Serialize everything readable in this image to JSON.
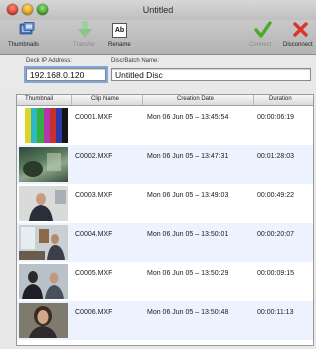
{
  "window": {
    "title": "Untitled"
  },
  "toolbar": {
    "thumbnails_label": "Thumbnails",
    "transfer_label": "Transfer",
    "rename_label": "Rename",
    "connect_label": "Connect",
    "disconnect_label": "Disconnect",
    "rename_icon_text": "Ab"
  },
  "fields": {
    "deck_ip_label": "Deck IP Address:",
    "deck_ip_value": "192.168.0.120",
    "disc_name_label": "Disc/Batch Name:",
    "disc_name_value": "Untitled Disc"
  },
  "table": {
    "headers": [
      "Thumbnail",
      "Clip Name",
      "Creation Date",
      "Duration"
    ],
    "rows": [
      {
        "thumb": "color-bars",
        "name": "C0001.MXF",
        "date": "Mon 06 Jun 05 – 13:45:54",
        "duration": "00:00:06:19"
      },
      {
        "thumb": "outdoor-scene",
        "name": "C0002.MXF",
        "date": "Mon 06 Jun 05 – 13:47:31",
        "duration": "00:01:28:03"
      },
      {
        "thumb": "man-in-office",
        "name": "C0003.MXF",
        "date": "Mon 06 Jun 05 – 13:49:03",
        "duration": "00:00:49:22"
      },
      {
        "thumb": "office-interior",
        "name": "C0004.MXF",
        "date": "Mon 06 Jun 05 – 13:50:01",
        "duration": "00:00:20:07"
      },
      {
        "thumb": "two-people",
        "name": "C0005.MXF",
        "date": "Mon 06 Jun 05 – 13:50:29",
        "duration": "00:00:09:15"
      },
      {
        "thumb": "woman-portrait",
        "name": "C0006.MXF",
        "date": "Mon 06 Jun 05 – 13:50:48",
        "duration": "00:00:11:13"
      }
    ]
  },
  "colors": {
    "row_alt": "#edf3fe",
    "connect_check": "#4caa2a",
    "disconnect_x": "#d8362a"
  }
}
